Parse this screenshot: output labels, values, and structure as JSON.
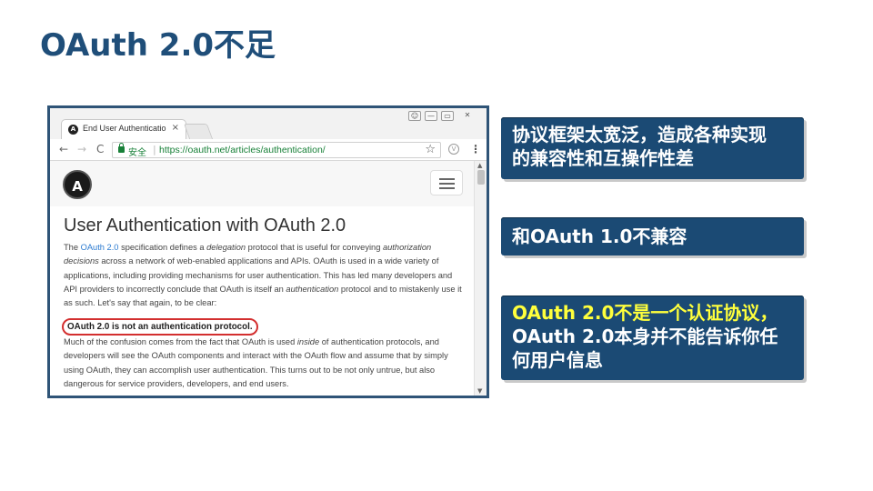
{
  "slide": {
    "title": "OAuth 2.0不足"
  },
  "browser": {
    "tab_label": "End User Authenticatio",
    "tab_close": "×",
    "win_controls": [
      "👤",
      "—",
      "▭",
      "✕"
    ],
    "nav_back": "←",
    "nav_forward": "→",
    "nav_reload": "C",
    "secure_label": "安全",
    "url": "https://oauth.net/articles/authentication/",
    "star": "☆",
    "ext": "V",
    "menu": "⋮"
  },
  "page": {
    "logo_letter": "A",
    "article_title": "User Authentication with OAuth 2.0",
    "para1": {
      "t1": "The ",
      "link": "OAuth 2.0",
      "t2": " specification defines a ",
      "i1": "delegation",
      "t3": " protocol that is useful for conveying ",
      "i2": "authorization decisions",
      "t4": " across a network of web-enabled applications and APIs. OAuth is used in a wide variety of applications, including providing mechanisms for user authentication. This has led many developers and API providers to incorrectly conclude that OAuth is itself an ",
      "i3": "authentication",
      "t5": " protocol and to mistakenly use it as such. Let's say that again, to be clear:"
    },
    "callout": "OAuth 2.0 is not an authentication protocol.",
    "para2": {
      "t1": "Much of the confusion comes from the fact that OAuth is used ",
      "i1": "inside",
      "t2": " of authentication protocols, and developers will see the OAuth components and interact with the OAuth flow and assume that by simply using OAuth, they can accomplish user authentication. This turns out to be not only untrue, but also dangerous for service providers, developers, and end users."
    }
  },
  "points": [
    {
      "line1": "协议框架太宽泛，造成各种实现",
      "line2": "的兼容性和互操作性差"
    },
    {
      "line1": "和OAuth 1.0不兼容"
    },
    {
      "hl1": "OAuth 2.0不是一个认证协议，",
      "line2": "OAuth 2.0本身并不能告诉你任",
      "line3": "何用户信息"
    }
  ],
  "colors": {
    "title": "#1f4e79",
    "box": "#1b4a74",
    "highlight": "#ffff3c",
    "callout_border": "#d32f2f",
    "link": "#2a7ad0",
    "secure": "#188038"
  }
}
